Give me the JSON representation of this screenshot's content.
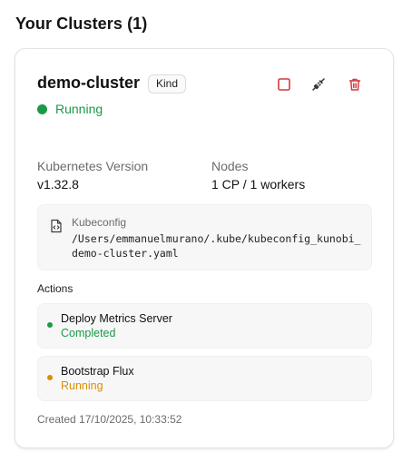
{
  "section": {
    "title": "Your Clusters (1)"
  },
  "cluster": {
    "name": "demo-cluster",
    "type_badge": "Kind",
    "status": "Running",
    "status_color": "#1a9a47",
    "kubernetes_version_label": "Kubernetes Version",
    "kubernetes_version": "v1.32.8",
    "nodes_label": "Nodes",
    "nodes": "1 CP / 1 workers",
    "kubeconfig_label": "Kubeconfig",
    "kubeconfig_path": "/Users/emmanuelmurano/.kube/kubeconfig_kunobi_demo-cluster.yaml",
    "created": "Created 17/10/2025, 10:33:52"
  },
  "toolbar": {
    "stop_icon": "stop-icon",
    "disconnect_icon": "unplug-icon",
    "delete_icon": "trash-icon",
    "icon_color": "#d43b3b"
  },
  "actions": {
    "title": "Actions",
    "items": [
      {
        "name": "Deploy Metrics Server",
        "status": "Completed",
        "color": "#1a9a47"
      },
      {
        "name": "Bootstrap Flux",
        "status": "Running",
        "color": "#d98f06"
      }
    ]
  }
}
